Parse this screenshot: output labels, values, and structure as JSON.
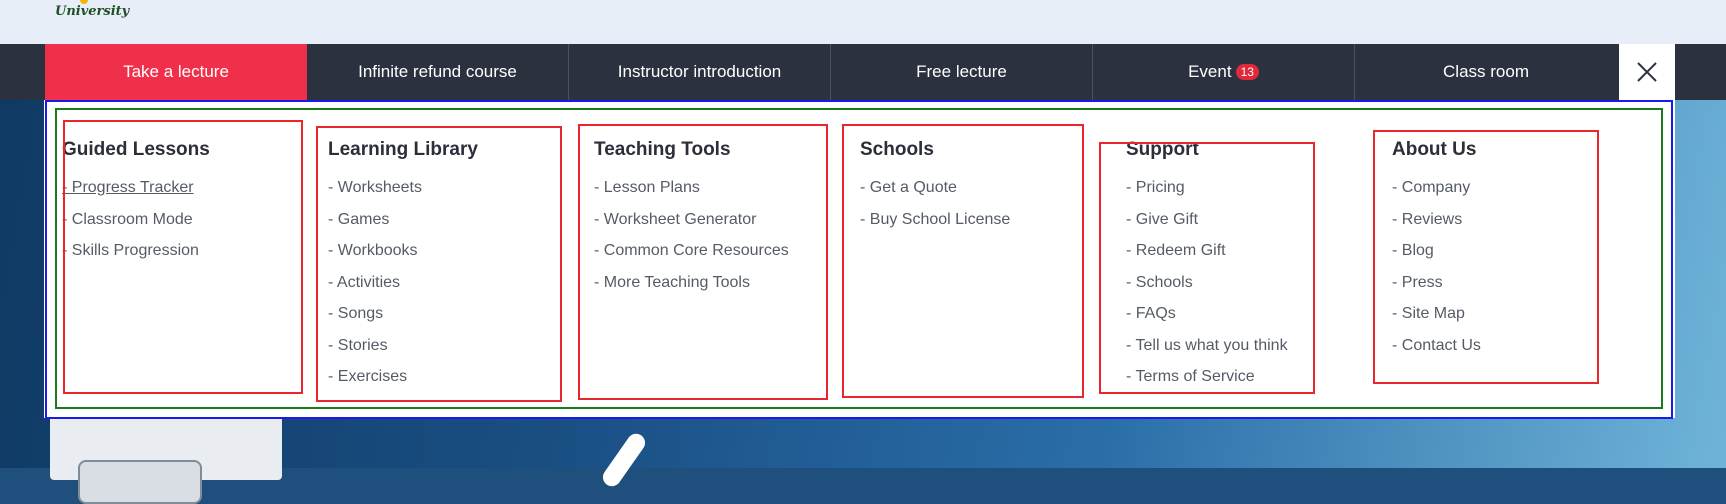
{
  "brand": {
    "logo_text": "University"
  },
  "nav": {
    "tabs": [
      {
        "label": "Take a lecture",
        "active": true
      },
      {
        "label": "Infinite refund course"
      },
      {
        "label": "Instructor introduction"
      },
      {
        "label": "Free lecture"
      },
      {
        "label": "Event",
        "badge": "13"
      },
      {
        "label": "Class room"
      }
    ],
    "close_icon": "close-icon",
    "accent_color": "#f0304a",
    "bar_color": "#2b313e"
  },
  "menu": {
    "columns": [
      {
        "heading": "Guided Lessons",
        "items": [
          "- Progress Tracker",
          "- Classroom Mode",
          "- Skills Progression"
        ]
      },
      {
        "heading": "Learning Library",
        "items": [
          "- Worksheets",
          "- Games",
          "- Workbooks",
          "- Activities",
          "- Songs",
          "- Stories",
          "- Exercises"
        ]
      },
      {
        "heading": "Teaching Tools",
        "items": [
          "- Lesson Plans",
          "- Worksheet Generator",
          "- Common Core Resources",
          "- More Teaching Tools"
        ]
      },
      {
        "heading": "Schools",
        "items": [
          "- Get a Quote",
          "- Buy School License"
        ]
      },
      {
        "heading": "Support",
        "items": [
          "- Pricing",
          "- Give Gift",
          "- Redeem Gift",
          "- Schools",
          "- FAQs",
          "- Tell us what you think",
          "- Terms of Service"
        ]
      },
      {
        "heading": "About Us",
        "items": [
          "- Company",
          "- Reviews",
          "- Blog",
          "- Press",
          "- Site Map",
          "- Contact Us"
        ]
      }
    ]
  }
}
